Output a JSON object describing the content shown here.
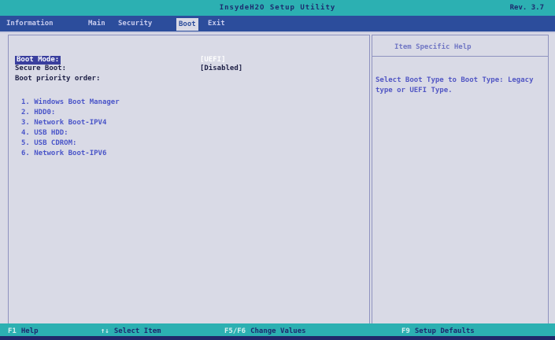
{
  "header": {
    "title": "InsydeH2O Setup Utility",
    "revision": "Rev. 3.7"
  },
  "menu": [
    {
      "label": "Information"
    },
    {
      "label": "Main"
    },
    {
      "label": "Security"
    },
    {
      "label": "Boot",
      "active": true
    },
    {
      "label": "Exit"
    }
  ],
  "settings": {
    "boot_mode": {
      "label": "Boot Mode:",
      "value": "[UEFI]"
    },
    "secure_boot": {
      "label": "Secure Boot:",
      "value": "[Disabled]"
    },
    "priority_heading": "Boot priority order:"
  },
  "boot_order": [
    "1.  Windows Boot Manager",
    "2.  HDD0:",
    "3.  Network Boot-IPV4",
    "4.  USB HDD:",
    "5.  USB CDROM:",
    "6.  Network Boot-IPV6"
  ],
  "help": {
    "title": "Item Specific Help",
    "text": "Select Boot Type to Boot Type: Legacy type or UEFI Type."
  },
  "footer": {
    "help": {
      "key": "F1",
      "label": "Help"
    },
    "select": {
      "key": "↑↓",
      "label": "Select Item"
    },
    "change": {
      "key": "F5/F6",
      "label": "Change Values"
    },
    "defaults": {
      "key": "F9",
      "label": "Setup Defaults"
    }
  },
  "colors": {
    "title_bar": "#2cb0b2",
    "menu_bar": "#2c4d9c",
    "body": "#d9dae6",
    "highlight_text": "#4a55c8"
  }
}
